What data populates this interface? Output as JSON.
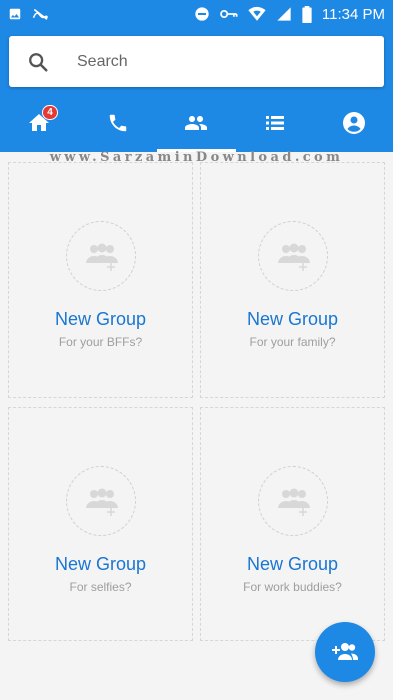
{
  "status_bar": {
    "time": "11:34 PM",
    "icons": [
      "image-icon",
      "silent-icon",
      "do-not-disturb-icon",
      "vpn-key-icon",
      "wifi-icon",
      "signal-icon",
      "battery-icon"
    ]
  },
  "search": {
    "placeholder": "Search"
  },
  "tabs": [
    {
      "name": "home-icon",
      "badge": "4"
    },
    {
      "name": "phone-icon"
    },
    {
      "name": "groups-icon",
      "active": true
    },
    {
      "name": "list-icon"
    },
    {
      "name": "profile-icon"
    }
  ],
  "watermark": "www.SarzaminDownload.com",
  "groups": [
    {
      "title": "New Group",
      "subtitle": "For your BFFs?"
    },
    {
      "title": "New Group",
      "subtitle": "For your family?"
    },
    {
      "title": "New Group",
      "subtitle": "For selfies?"
    },
    {
      "title": "New Group",
      "subtitle": "For work buddies?"
    }
  ],
  "colors": {
    "primary": "#1e88e5",
    "accent_text": "#1976d2",
    "badge": "#e53935"
  },
  "fab": {
    "icon": "add-group-icon"
  }
}
